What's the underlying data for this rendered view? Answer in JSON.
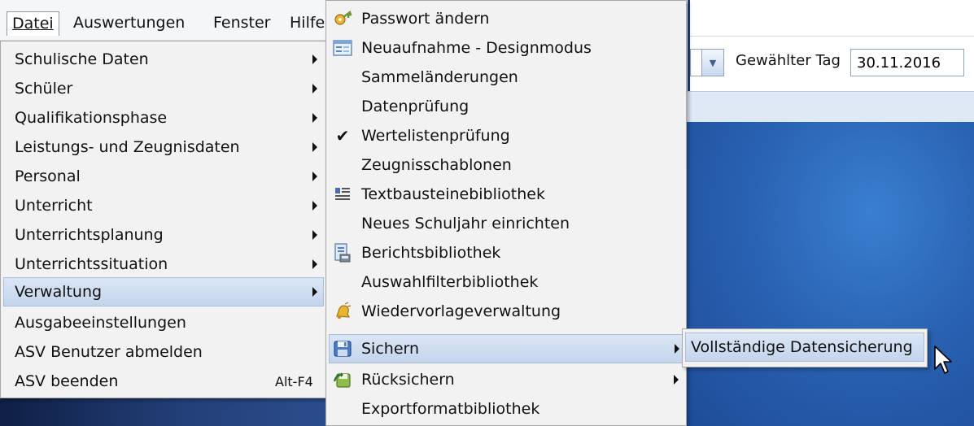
{
  "menubar": {
    "items": [
      {
        "label": "Datei"
      },
      {
        "label": "Auswertungen"
      },
      {
        "label": "Fenster"
      },
      {
        "label": "Hilfe"
      }
    ]
  },
  "datei_menu": {
    "items": [
      {
        "label": "Schulische Daten"
      },
      {
        "label": "Schüler"
      },
      {
        "label": "Qualifikationsphase"
      },
      {
        "label": "Leistungs- und Zeugnisdaten"
      },
      {
        "label": "Personal"
      },
      {
        "label": "Unterricht"
      },
      {
        "label": "Unterrichtsplanung"
      },
      {
        "label": "Unterrichtssituation"
      },
      {
        "label": "Verwaltung"
      },
      {
        "label": "Ausgabeeinstellungen"
      },
      {
        "label": "ASV Benutzer abmelden"
      },
      {
        "label": "ASV beenden",
        "shortcut": "Alt-F4"
      }
    ]
  },
  "verwaltung_menu": {
    "items": [
      {
        "label": "Passwort ändern",
        "icon": "key-icon"
      },
      {
        "label": "Neuaufnahme - Designmodus",
        "icon": "form-icon"
      },
      {
        "label": "Sammeländerungen"
      },
      {
        "label": "Datenprüfung"
      },
      {
        "label": "Wertelistenprüfung",
        "icon": "checkmark-icon"
      },
      {
        "label": "Zeugnisschablonen"
      },
      {
        "label": "Textbausteinebibliothek",
        "icon": "text-lines-icon"
      },
      {
        "label": "Neues Schuljahr einrichten"
      },
      {
        "label": "Berichtsbibliothek",
        "icon": "report-icon"
      },
      {
        "label": "Auswahlfilterbibliothek"
      },
      {
        "label": "Wiedervorlageverwaltung",
        "icon": "bell-icon"
      },
      {
        "label": "Sichern",
        "icon": "save-icon"
      },
      {
        "label": "Rücksichern",
        "icon": "restore-icon"
      },
      {
        "label": "Exportformatbibliothek"
      }
    ]
  },
  "sichern_menu": {
    "items": [
      {
        "label": "Vollständige Datensicherung"
      }
    ]
  },
  "toolbar": {
    "day_label": "Gewählter Tag",
    "day_value": "30.11.2016"
  },
  "colors": {
    "menu_bg": "#f2f2f2",
    "highlight": "#c3d4ec",
    "desktop_blue": "#2a62b3"
  }
}
